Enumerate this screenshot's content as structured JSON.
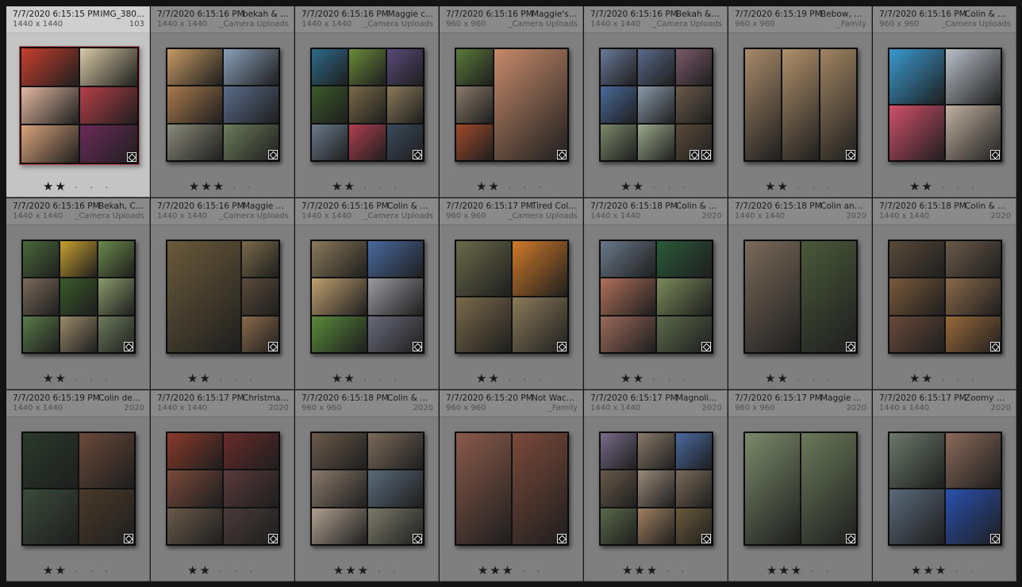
{
  "grid": {
    "cells": [
      {
        "timestamp": "7/7/2020 6:15:15 PM",
        "filename": "IMG_380...",
        "dims": "1440 x 1440",
        "folder": "103",
        "stars": 2,
        "selected": true,
        "layout": "g2x3",
        "colors": [
          "#c9402f",
          "#d8c9a5",
          "#e3b8a0",
          "#b53f49",
          "#d9a37a",
          "#6b2b5a"
        ]
      },
      {
        "timestamp": "7/7/2020 6:15:16 PM",
        "filename": "bekah & k...",
        "dims": "1440 x 1440",
        "folder": "_Camera Uploads",
        "stars": 3,
        "layout": "g3x2",
        "colors": [
          "#c79a64",
          "#8aa0b8",
          "#a97a4c",
          "#5a6b8a",
          "#8a8a7a",
          "#6b7c5a"
        ]
      },
      {
        "timestamp": "7/7/2020 6:15:16 PM",
        "filename": "Maggie c...",
        "dims": "1440 x 1440",
        "folder": "_Camera Uploads",
        "stars": 2,
        "layout": "g3x3",
        "colors": [
          "#2e6b8a",
          "#6a8a3a",
          "#5a4a7a",
          "#3a5a2a",
          "#7a6a4a",
          "#8a7a5a",
          "#6a7a8a",
          "#b04050",
          "#3a4a5a"
        ]
      },
      {
        "timestamp": "7/7/2020 6:15:16 PM",
        "filename": "Maggie's ...",
        "dims": "960 x 960",
        "folder": "_Camera Uploads",
        "stars": 2,
        "layout": "left3right1",
        "colors": [
          "#5a7a3a",
          "#8a7a6a",
          "#a04a2a",
          "#c78a6a"
        ]
      },
      {
        "timestamp": "7/7/2020 6:15:16 PM",
        "filename": "Bekah & k...",
        "dims": "1440 x 1440",
        "folder": "_Camera Uploads",
        "stars": 2,
        "layout": "g3x3",
        "colors": [
          "#6a7a9a",
          "#5a6a8a",
          "#7a5a6a",
          "#4a6a9a",
          "#8a9aaa",
          "#6a5a4a",
          "#7a8a6a",
          "#9aaa8a",
          "#5a4a3a"
        ],
        "badge2": true
      },
      {
        "timestamp": "7/7/2020 6:15:19 PM",
        "filename": "Bebow, m...",
        "dims": "960 x 960",
        "folder": "_Family",
        "stars": 2,
        "layout": "c3",
        "colors": [
          "#a88a6a",
          "#b0906a",
          "#a08462"
        ]
      },
      {
        "timestamp": "7/7/2020 6:15:16 PM",
        "filename": "Colin & M...",
        "dims": "960 x 960",
        "folder": "_Camera Uploads",
        "stars": 2,
        "layout": "g2x2",
        "colors": [
          "#3a9ad0",
          "#b8c0c8",
          "#d0506a",
          "#c0b0a0"
        ]
      },
      {
        "timestamp": "7/7/2020 6:15:16 PM",
        "filename": "Bekah, Cu...",
        "dims": "1440 x 1440",
        "folder": "_Camera Uploads",
        "stars": 2,
        "layout": "g3x3",
        "colors": [
          "#4a6a3a",
          "#c8a030",
          "#6a8a4a",
          "#7a6a5a",
          "#3a5a2a",
          "#8a9a6a",
          "#5a7a4a",
          "#9a8a6a",
          "#6a7a5a"
        ]
      },
      {
        "timestamp": "7/7/2020 6:15:16 PM",
        "filename": "Maggie at...",
        "dims": "1440 x 1440",
        "folder": "_Camera Uploads",
        "stars": 2,
        "layout": "left1right3",
        "colors": [
          "#6a5a3a",
          "#7a6a4a",
          "#5a4a3a",
          "#8a6a4a"
        ]
      },
      {
        "timestamp": "7/7/2020 6:15:16 PM",
        "filename": "Colin & M...",
        "dims": "1440 x 1440",
        "folder": "_Camera Uploads",
        "stars": 2,
        "layout": "g3x2",
        "colors": [
          "#8a7a5a",
          "#4a6aa0",
          "#c0a070",
          "#9a9aa0",
          "#5a8a3a",
          "#6a6a7a"
        ]
      },
      {
        "timestamp": "7/7/2020 6:15:17 PM",
        "filename": "Tired Coli...",
        "dims": "960 x 960",
        "folder": "_Camera Uploads",
        "stars": 2,
        "layout": "g2x2",
        "colors": [
          "#6a6a4a",
          "#d07a2a",
          "#7a6a4a",
          "#8a7a5a"
        ]
      },
      {
        "timestamp": "7/7/2020 6:15:18 PM",
        "filename": "Colin & M...",
        "dims": "1440 x 1440",
        "folder": "2020",
        "stars": 2,
        "layout": "g3x2",
        "colors": [
          "#6a7a8a",
          "#2a5a3a",
          "#b0705a",
          "#7a8a5a",
          "#9a6a5a",
          "#5a6a4a"
        ]
      },
      {
        "timestamp": "7/7/2020 6:15:18 PM",
        "filename": "Colin and ...",
        "dims": "1440 x 1440",
        "folder": "2020",
        "stars": 2,
        "layout": "c2",
        "colors": [
          "#7a6a5a",
          "#4a5a3a"
        ]
      },
      {
        "timestamp": "7/7/2020 6:15:18 PM",
        "filename": "Colin & M...",
        "dims": "1440 x 1440",
        "folder": "2020",
        "stars": 2,
        "layout": "g3x2",
        "colors": [
          "#5a4a3a",
          "#6a5a4a",
          "#7a5a3a",
          "#8a6a4a",
          "#6a4a3a",
          "#9a6a3a"
        ]
      },
      {
        "timestamp": "7/7/2020 6:15:19 PM",
        "filename": "Colin dec...",
        "dims": "1440 x 1440",
        "folder": "2020",
        "stars": 2,
        "layout": "g2x2",
        "colors": [
          "#2a3a2a",
          "#6a4a3a",
          "#3a4a3a",
          "#4a3a2a"
        ]
      },
      {
        "timestamp": "7/7/2020 6:15:17 PM",
        "filename": "Christmas...",
        "dims": "1440 x 1440",
        "folder": "2020",
        "stars": 2,
        "layout": "g3x2",
        "colors": [
          "#8a3a2a",
          "#6a2a2a",
          "#7a4a3a",
          "#5a3a3a",
          "#6a5a4a",
          "#4a3a3a"
        ]
      },
      {
        "timestamp": "7/7/2020 6:15:18 PM",
        "filename": "Colin & M...",
        "dims": "960 x 960",
        "folder": "2020",
        "stars": 3,
        "layout": "g3x2",
        "colors": [
          "#6a5a4a",
          "#7a6a5a",
          "#8a7a6a",
          "#5a6a7a",
          "#b0a090",
          "#7a7a6a"
        ]
      },
      {
        "timestamp": "7/7/2020 6:15:20 PM",
        "filename": "Not Wack...",
        "dims": "960 x 960",
        "folder": "_Family",
        "stars": 3,
        "layout": "c2",
        "colors": [
          "#8a5a4a",
          "#7a4a3a"
        ]
      },
      {
        "timestamp": "7/7/2020 6:15:17 PM",
        "filename": "Magnolia'...",
        "dims": "1440 x 1440",
        "folder": "2020",
        "stars": 3,
        "layout": "g3x3",
        "colors": [
          "#7a6a8a",
          "#8a7a6a",
          "#4a6aa0",
          "#6a5a4a",
          "#9a8a7a",
          "#7a6a5a",
          "#5a6a4a",
          "#a08060",
          "#6a5a3a"
        ]
      },
      {
        "timestamp": "7/7/2020 6:15:17 PM",
        "filename": "Maggie w...",
        "dims": "960 x 960",
        "folder": "2020",
        "stars": 3,
        "layout": "c2",
        "colors": [
          "#7a8a6a",
          "#6a7a5a"
        ]
      },
      {
        "timestamp": "7/7/2020 6:15:17 PM",
        "filename": "Zoomy M...",
        "dims": "1440 x 1440",
        "folder": "2020",
        "stars": 3,
        "layout": "g2x2",
        "colors": [
          "#6a7a6a",
          "#8a6a5a",
          "#5a6a7a",
          "#2a50b0"
        ]
      }
    ]
  }
}
